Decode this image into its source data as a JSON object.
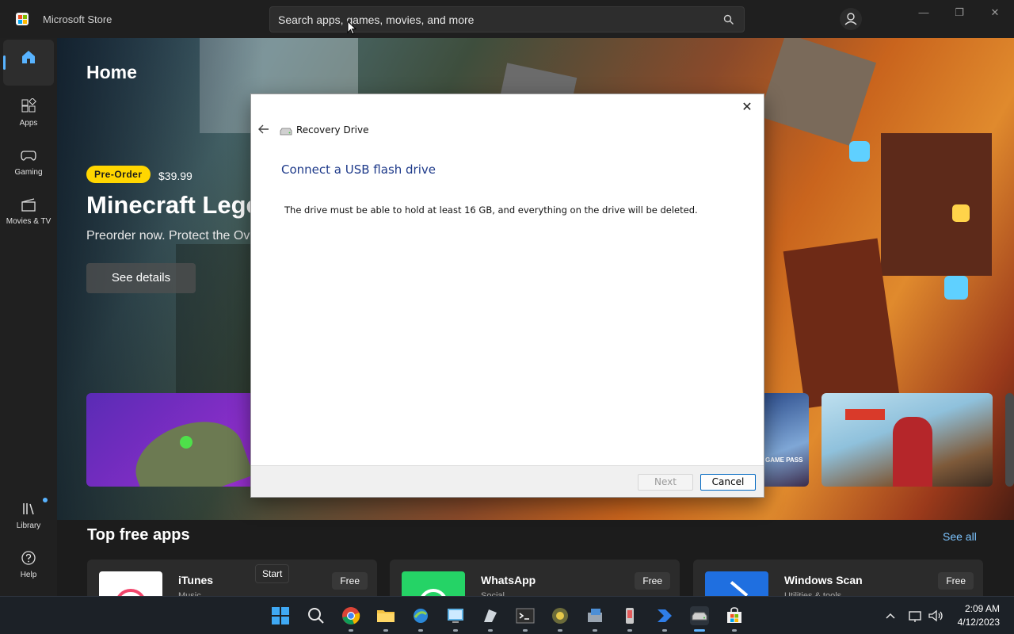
{
  "window": {
    "app_title": "Microsoft Store",
    "search_placeholder": "Search apps, games, movies, and more"
  },
  "nav": {
    "items": [
      {
        "label": "",
        "icon": "home-icon"
      },
      {
        "label": "Apps",
        "icon": "apps-icon"
      },
      {
        "label": "Gaming",
        "icon": "gamepad-icon"
      },
      {
        "label": "Movies & TV",
        "icon": "movies-icon"
      },
      {
        "label": "Library",
        "icon": "library-icon"
      },
      {
        "label": "Help",
        "icon": "help-icon"
      }
    ]
  },
  "hero": {
    "page_title": "Home",
    "badge": "Pre-Order",
    "price": "$39.99",
    "title": "Minecraft Lege",
    "subtitle": "Preorder now. Protect the Ov",
    "cta": "See details",
    "card_label": "GAME PASS"
  },
  "section": {
    "title": "Top free apps",
    "see_all": "See all",
    "apps": [
      {
        "name": "iTunes",
        "category": "Music",
        "price": "Free"
      },
      {
        "name": "WhatsApp",
        "category": "Social",
        "price": "Free"
      },
      {
        "name": "Windows Scan",
        "category": "Utilities & tools",
        "price": "Free"
      }
    ],
    "tooltip": "Start"
  },
  "dialog": {
    "window_title": "Recovery Drive",
    "heading": "Connect a USB flash drive",
    "body": "The drive must be able to hold at least 16 GB, and everything on the drive will be deleted.",
    "next_label": "Next",
    "cancel_label": "Cancel",
    "close_glyph": "✕"
  },
  "taskbar": {
    "time": "2:09 AM",
    "date": "4/12/2023"
  },
  "colors": {
    "accent": "#58b3ff",
    "badge": "#ffd600",
    "dialog_heading": "#1e3a8a"
  }
}
